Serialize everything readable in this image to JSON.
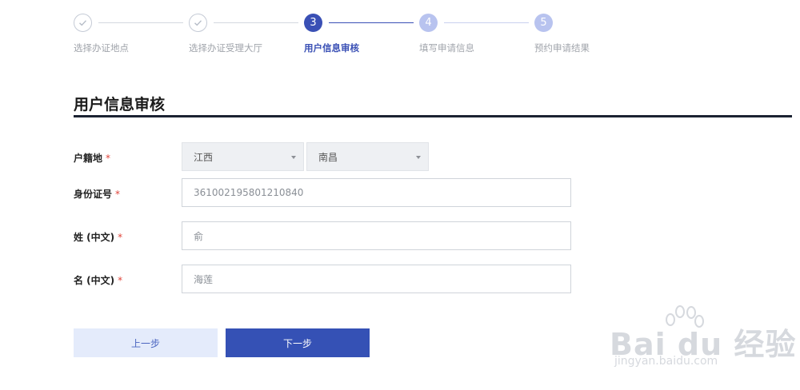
{
  "stepper": {
    "steps": [
      {
        "label": "选择办证地点",
        "number": "1",
        "state": "done"
      },
      {
        "label": "选择办证受理大厅",
        "number": "2",
        "state": "done"
      },
      {
        "label": "用户信息审核",
        "number": "3",
        "state": "active"
      },
      {
        "label": "填写申请信息",
        "number": "4",
        "state": "todo"
      },
      {
        "label": "预约申请结果",
        "number": "5",
        "state": "todo"
      }
    ]
  },
  "section": {
    "title": "用户信息审核"
  },
  "form": {
    "required_mark": "*",
    "household": {
      "label": "户籍地",
      "province": "江西",
      "city": "南昌"
    },
    "id_number": {
      "label": "身份证号",
      "value": "361002195801210840"
    },
    "surname": {
      "label": "姓 (中文)",
      "value": "俞"
    },
    "given_name": {
      "label": "名 (中文)",
      "value": "海莲"
    }
  },
  "buttons": {
    "prev": "上一步",
    "next": "下一步"
  },
  "watermark": {
    "brand": "Bai du 经验",
    "url": "jingyan.baidu.com"
  },
  "colors": {
    "accent": "#3a50b5",
    "required": "#e0443a",
    "todo": "#b8c3ef"
  }
}
